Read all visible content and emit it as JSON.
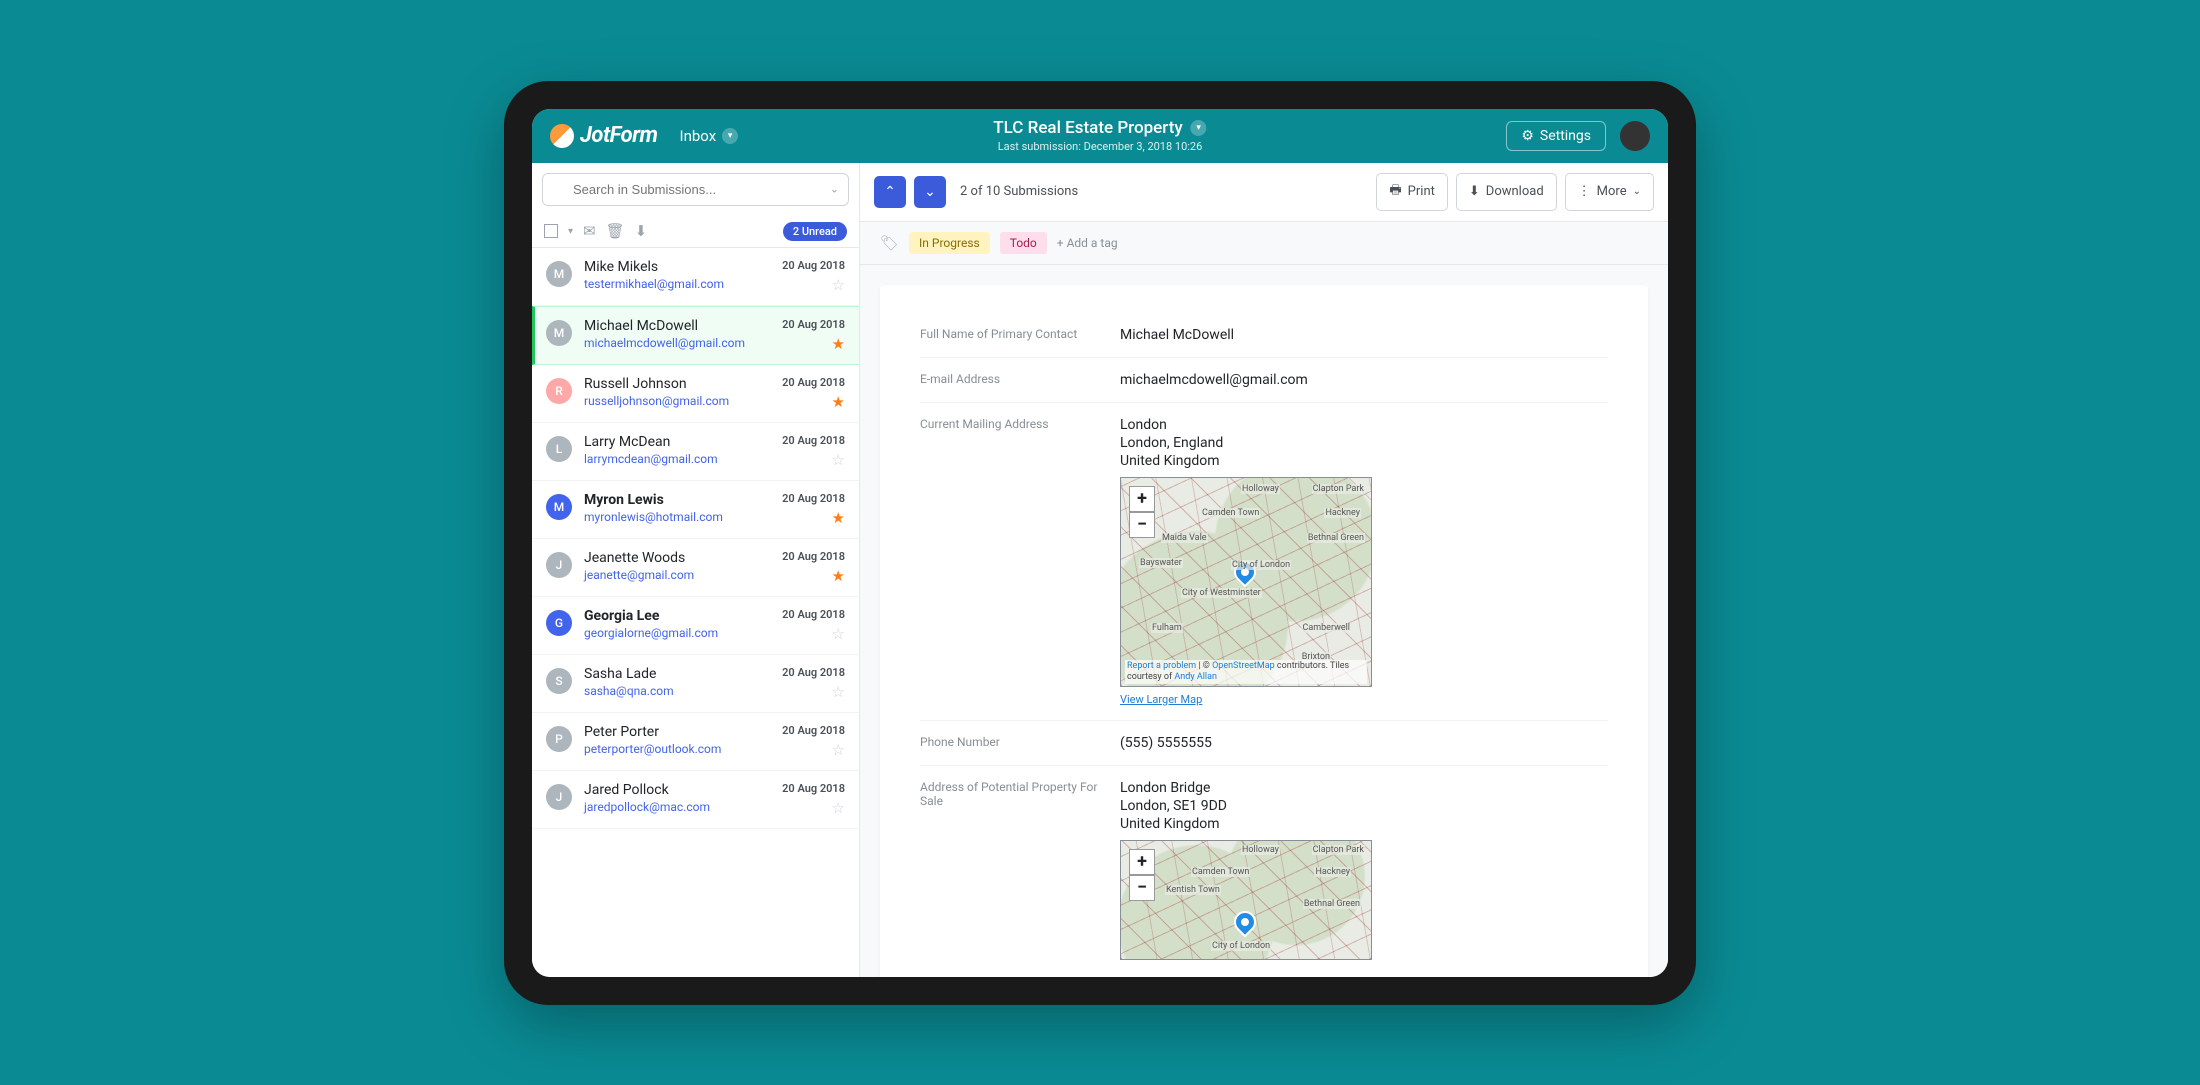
{
  "header": {
    "brand": "JotForm",
    "inbox_label": "Inbox",
    "title": "TLC Real Estate Property",
    "subtitle": "Last submission: December 3, 2018 10:26",
    "settings_label": "Settings"
  },
  "sidebar": {
    "search_placeholder": "Search in Submissions...",
    "unread_badge": "2 Unread",
    "items": [
      {
        "initial": "M",
        "name": "Mike Mikels",
        "email": "testermikhael@gmail.com",
        "date": "20 Aug 2018",
        "starred": false,
        "color": "#adb5bd",
        "unread": false
      },
      {
        "initial": "M",
        "name": "Michael McDowell",
        "email": "michaelmcdowell@gmail.com",
        "date": "20 Aug 2018",
        "starred": true,
        "color": "#adb5bd",
        "unread": false,
        "selected": true
      },
      {
        "initial": "R",
        "name": "Russell Johnson",
        "email": "russelljohnson@gmail.com",
        "date": "20 Aug 2018",
        "starred": true,
        "color": "#ffa8a8",
        "unread": false
      },
      {
        "initial": "L",
        "name": "Larry McDean",
        "email": "larrymcdean@gmail.com",
        "date": "20 Aug 2018",
        "starred": false,
        "color": "#adb5bd",
        "unread": false
      },
      {
        "initial": "M",
        "name": "Myron Lewis",
        "email": "myronlewis@hotmail.com",
        "date": "20 Aug 2018",
        "starred": true,
        "color": "#4263eb",
        "unread": true
      },
      {
        "initial": "J",
        "name": "Jeanette Woods",
        "email": "jeanette@gmail.com",
        "date": "20 Aug 2018",
        "starred": true,
        "color": "#adb5bd",
        "unread": false
      },
      {
        "initial": "G",
        "name": "Georgia Lee",
        "email": "georgialorne@gmail.com",
        "date": "20 Aug 2018",
        "starred": false,
        "color": "#4263eb",
        "unread": true
      },
      {
        "initial": "S",
        "name": "Sasha Lade",
        "email": "sasha@qna.com",
        "date": "20 Aug 2018",
        "starred": false,
        "color": "#adb5bd",
        "unread": false
      },
      {
        "initial": "P",
        "name": "Peter Porter",
        "email": "peterporter@outlook.com",
        "date": "20 Aug 2018",
        "starred": false,
        "color": "#adb5bd",
        "unread": false
      },
      {
        "initial": "J",
        "name": "Jared Pollock",
        "email": "jaredpollock@mac.com",
        "date": "20 Aug 2018",
        "starred": false,
        "color": "#adb5bd",
        "unread": false
      }
    ]
  },
  "toolbar": {
    "pager": "2 of 10 Submissions",
    "print": "Print",
    "download": "Download",
    "more": "More"
  },
  "tags": {
    "in_progress": "In Progress",
    "todo": "Todo",
    "add_tag": "+ Add a tag"
  },
  "detail": {
    "fields": {
      "full_name": {
        "label": "Full Name of Primary Contact",
        "value": "Michael McDowell"
      },
      "email": {
        "label": "E-mail Address",
        "value": "michaelmcdowell@gmail.com"
      },
      "mailing_address": {
        "label": "Current Mailing Address",
        "line1": "London",
        "line2": "London, England",
        "line3": "United Kingdom"
      },
      "phone": {
        "label": "Phone Number",
        "value": "(555) 5555555"
      },
      "property_address": {
        "label": "Address of Potential Property For Sale",
        "line1": "London Bridge",
        "line2": "London, SE1 9DD",
        "line3": "United Kingdom"
      }
    },
    "map": {
      "larger_link": "View Larger Map",
      "report": "Report a problem",
      "osm": "OpenStreetMap",
      "attr_text": " contributors. Tiles courtesy of ",
      "andy": "Andy Allan",
      "labels": [
        "Holloway",
        "Clapton Park",
        "Camden Town",
        "Hackney",
        "Maida Vale",
        "Bethnal Green",
        "Bayswater",
        "City of London",
        "City of Westminster",
        "Fulham",
        "Camberwell",
        "Brixton"
      ]
    },
    "map2_labels": [
      "Holloway",
      "Clapton Park",
      "Camden Town",
      "Hackney",
      "Kentish Town",
      "Bethnal Green",
      "City of London"
    ]
  }
}
